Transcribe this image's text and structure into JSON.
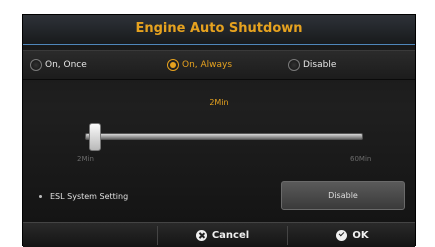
{
  "dialog": {
    "title": "Engine Auto Shutdown"
  },
  "radios": [
    {
      "label": "On, Once",
      "selected": false
    },
    {
      "label": "On, Always",
      "selected": true
    },
    {
      "label": "Disable",
      "selected": false
    }
  ],
  "slider": {
    "value_label": "2Min",
    "min_label": "2Min",
    "max_label": "60Min",
    "value": 2
  },
  "esl": {
    "label": "ESL System Setting",
    "button_label": "Disable"
  },
  "buttons": {
    "cancel_label": "Cancel",
    "ok_label": "OK"
  },
  "colors": {
    "accent": "#e6a21f",
    "title_underline": "#4f86b9"
  }
}
